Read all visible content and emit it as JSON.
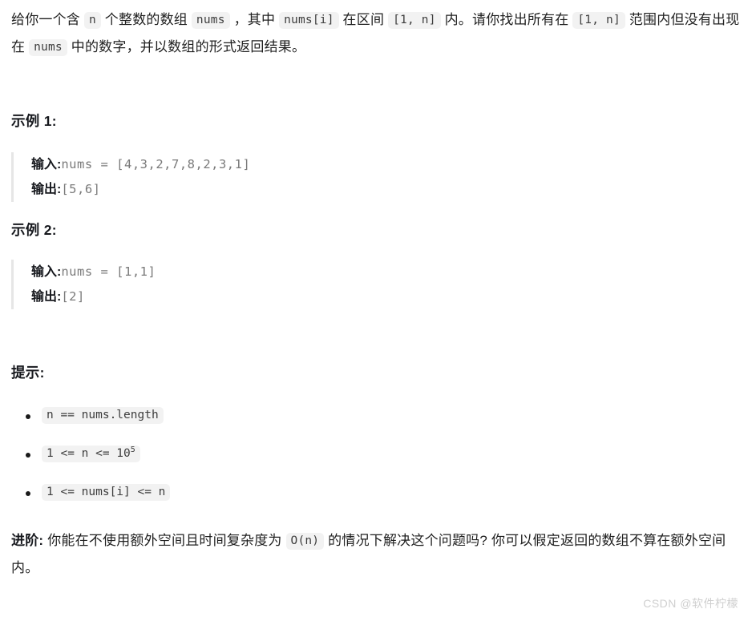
{
  "intro": {
    "seg1": "给你一个含 ",
    "code_n": "n",
    "seg2": " 个整数的数组 ",
    "code_nums": "nums",
    "seg3": " ，其中 ",
    "code_numsi": "nums[i]",
    "seg4": " 在区间 ",
    "code_range1": "[1, n]",
    "seg5": " 内。请你找出所有在 ",
    "code_range2": "[1, n]",
    "seg6": " 范围内但没有出现在 ",
    "code_nums2": "nums",
    "seg7": " 中的数字，并以数组的形式返回结果。"
  },
  "examples": [
    {
      "heading": "示例 1:",
      "input_label": "输入:",
      "input_value": "nums = [4,3,2,7,8,2,3,1]",
      "output_label": "输出:",
      "output_value": "[5,6]"
    },
    {
      "heading": "示例 2:",
      "input_label": "输入:",
      "input_value": "nums = [1,1]",
      "output_label": "输出:",
      "output_value": "[2]"
    }
  ],
  "hints": {
    "heading": "提示:",
    "items": [
      {
        "text": "n == nums.length",
        "sup": ""
      },
      {
        "text": "1 <= n <= 10",
        "sup": "5"
      },
      {
        "text": "1 <= nums[i] <= n",
        "sup": ""
      }
    ]
  },
  "advanced": {
    "label": "进阶:",
    "seg1": " 你能在不使用额外空间且时间复杂度为 ",
    "code": "O(n)",
    "seg2": " 的情况下解决这个问题吗? 你可以假定返回的数组不算在额外空间内。"
  },
  "watermark": "CSDN @软件柠檬",
  "colors": {
    "background": "#ffffff",
    "text": "#1f1f1f",
    "code_background": "#f2f2f2",
    "code_text": "#3d3d3d",
    "example_value_text": "#7a7a7a",
    "quote_border": "#e6e6e6",
    "watermark_text": "#cfcfcf"
  }
}
